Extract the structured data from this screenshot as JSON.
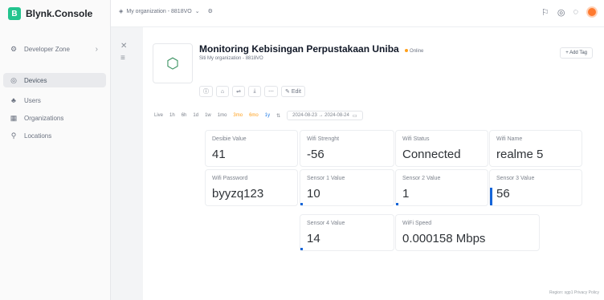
{
  "app": {
    "brand": "Blynk.Console",
    "logo_letter": "B"
  },
  "sidebar": {
    "items": [
      {
        "label": "Developer Zone",
        "icon": "gear-icon",
        "glyph": "⚙"
      },
      {
        "label": "Devices",
        "icon": "device-icon",
        "glyph": "◎"
      },
      {
        "label": "Users",
        "icon": "users-icon",
        "glyph": "♣"
      },
      {
        "label": "Organizations",
        "icon": "building-icon",
        "glyph": "▦"
      },
      {
        "label": "Locations",
        "icon": "pin-icon",
        "glyph": "⚲"
      }
    ]
  },
  "topbar": {
    "org": "My organization - 8818VO",
    "accent": "#ff7a2f"
  },
  "device": {
    "title": "Monitoring Kebisingan Perpustakaan Uniba",
    "status": "Online",
    "subtitle": "Siti  My organization - 8818VO",
    "add_tag": "+ Add Tag",
    "edit": "Edit"
  },
  "timeranges": [
    "Live",
    "1h",
    "6h",
    "1d",
    "1w",
    "1mo",
    "3mo",
    "6mo",
    "1y"
  ],
  "daterange": "2024-08-23 → 2024-08-24",
  "widgets": [
    {
      "title": "Desibie Value",
      "value": "41",
      "bar": false
    },
    {
      "title": "Wifi Strenght",
      "value": "-56",
      "bar": false
    },
    {
      "title": "Wifi Status",
      "value": "Connected",
      "bar": false
    },
    {
      "title": "Wifi Name",
      "value": "realme 5",
      "bar": false
    },
    {
      "title": "Wifi Password",
      "value": "byyzq123",
      "bar": false
    },
    {
      "title": "Sensor 1 Value",
      "value": "10",
      "bar": true,
      "level": 0.05
    },
    {
      "title": "Sensor 2 Value",
      "value": "1",
      "bar": true,
      "level": 0.02
    },
    {
      "title": "Sensor 3 Value",
      "value": "56",
      "bar": true,
      "level": 0.5
    },
    {
      "title": "Sensor 4 Value",
      "value": "14",
      "bar": true,
      "level": 0.06
    },
    {
      "title": "WiFi Speed",
      "value": "0.000158 Mbps",
      "bar": false
    }
  ],
  "footer": "Region: sgp1  Privacy Policy"
}
